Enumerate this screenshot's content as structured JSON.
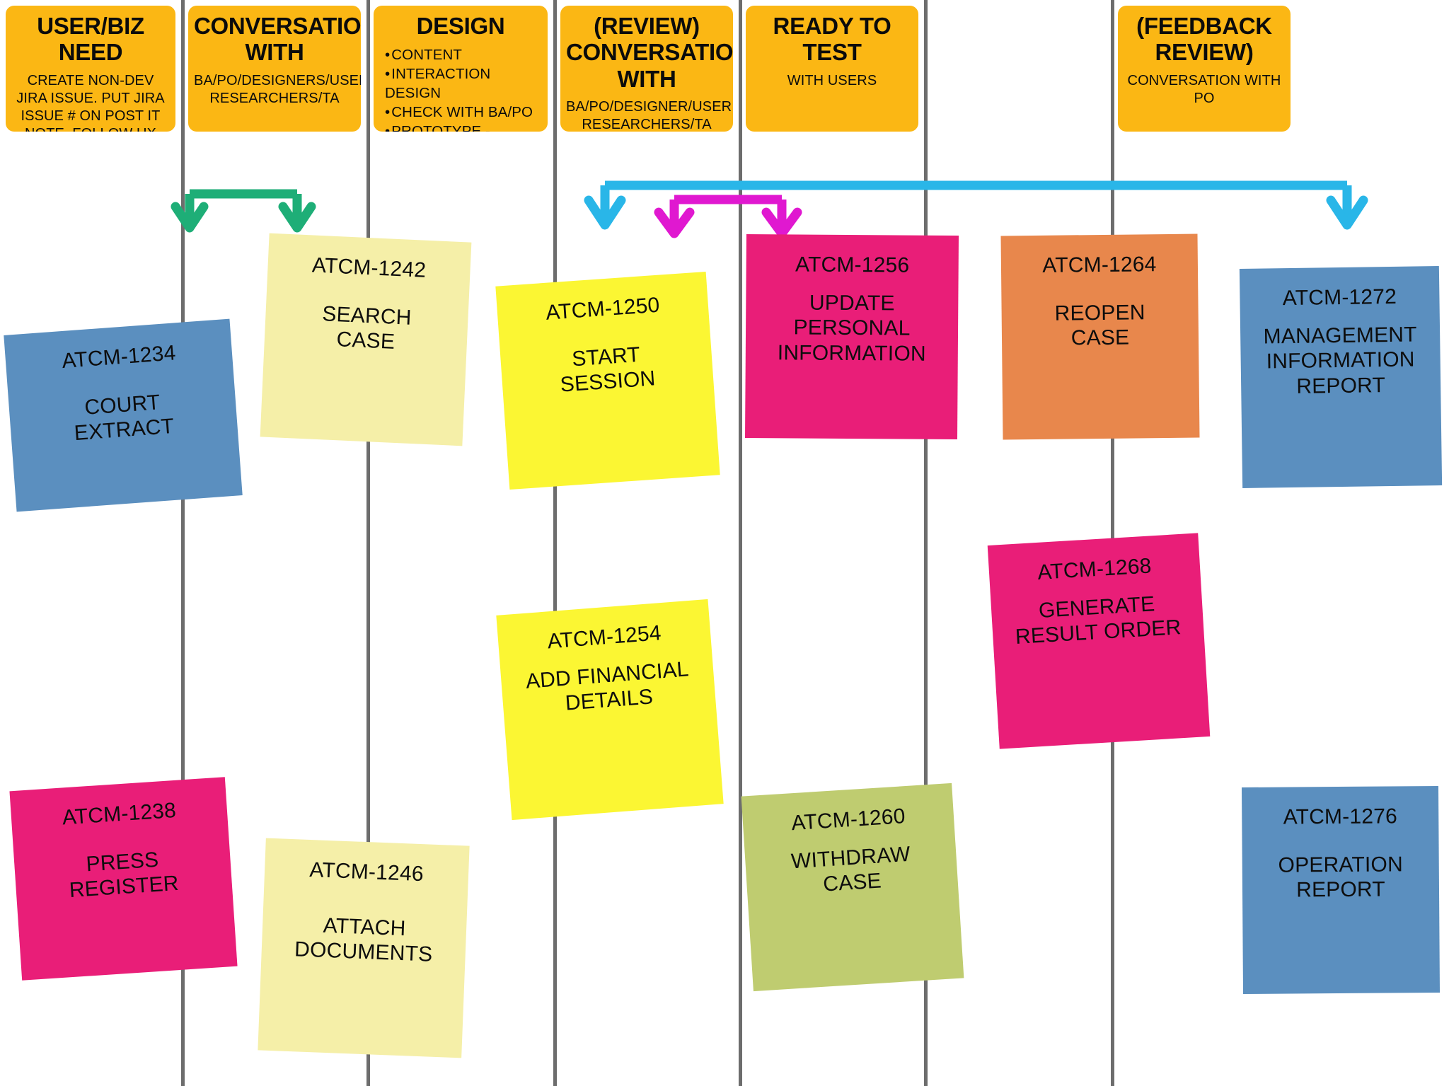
{
  "board": {
    "type": "user-story-map",
    "background_color": "#ffffff",
    "divider_color": "#6d6d6d",
    "header_color": "#FBB714"
  },
  "columns": [
    {
      "id": "user-biz-need",
      "title": "USER/BIZ NEED",
      "subtitle": "CREATE NON-DEV JIRA ISSUE. PUT JIRA ISSUE # ON POST IT NOTE. FOLLOW UX TEMPLATE FOR NEED",
      "bullets": []
    },
    {
      "id": "conversation-with",
      "title": "CONVERSATION WITH",
      "subtitle": "BA/PO/DESIGNERS/USER RESEARCHERS/TA",
      "bullets": []
    },
    {
      "id": "design",
      "title": "DESIGN",
      "subtitle": "",
      "bullets": [
        "CONTENT",
        "INTERACTION DESIGN",
        "CHECK WITH BA/PO",
        "PROTOTYPE - FRONT END"
      ]
    },
    {
      "id": "review-conversation-with",
      "title": "(REVIEW) CONVERSATION WITH",
      "subtitle": "BA/PO/DESIGNER/USER RESEARCHERS/TA",
      "bullets": []
    },
    {
      "id": "ready-to-test",
      "title": "READY TO TEST",
      "subtitle": "WITH USERS",
      "bullets": []
    },
    {
      "id": "feedback-review",
      "title": "(FEEDBACK REVIEW)",
      "subtitle": "CONVERSATION WITH PO",
      "bullets": []
    }
  ],
  "notes": [
    {
      "id": "ATCM-1234",
      "body": "COURT\nEXTRACT",
      "color": "#5B8FBF",
      "column": "user-biz-need"
    },
    {
      "id": "ATCM-1238",
      "body": "PRESS\nREGISTER",
      "color": "#E91E78",
      "column": "user-biz-need"
    },
    {
      "id": "ATCM-1242",
      "body": "SEARCH\nCASE",
      "color": "#F5EFA8",
      "column": "conversation-with"
    },
    {
      "id": "ATCM-1246",
      "body": "ATTACH\nDOCUMENTS",
      "color": "#F5EFA8",
      "column": "conversation-with"
    },
    {
      "id": "ATCM-1250",
      "body": "START\nSESSION",
      "color": "#FBF633",
      "column": "design"
    },
    {
      "id": "ATCM-1254",
      "body": "ADD FINANCIAL\nDETAILS",
      "color": "#FBF633",
      "column": "design"
    },
    {
      "id": "ATCM-1256",
      "body": "UPDATE\nPERSONAL\nINFORMATION",
      "color": "#E91E78",
      "column": "review-conversation-with"
    },
    {
      "id": "ATCM-1260",
      "body": "WITHDRAW\nCASE",
      "color": "#BFCC70",
      "column": "review-conversation-with"
    },
    {
      "id": "ATCM-1264",
      "body": "REOPEN\nCASE",
      "color": "#E8874C",
      "column": "ready-to-test"
    },
    {
      "id": "ATCM-1268",
      "body": "GENERATE\nRESULT ORDER",
      "color": "#E91E78",
      "column": "ready-to-test"
    },
    {
      "id": "ATCM-1272",
      "body": "MANAGEMENT\nINFORMATION\nREPORT",
      "color": "#5B8FBF",
      "column": "feedback-review"
    },
    {
      "id": "ATCM-1276",
      "body": "OPERATION\nREPORT",
      "color": "#5B8FBF",
      "column": "feedback-review"
    }
  ],
  "connectors": [
    {
      "name": "green-bracket",
      "color": "#1EAE77",
      "arrows": 2,
      "from_column": "user-biz-need",
      "to_columns": [
        "user-biz-need",
        "conversation-with"
      ]
    },
    {
      "name": "cyan-bracket",
      "color": "#29B6E8",
      "arrows": 2,
      "from_column": "design",
      "to_columns": [
        "design",
        "feedback-review"
      ]
    },
    {
      "name": "magenta-bracket",
      "color": "#E018D0",
      "arrows": 2,
      "from_column": "design",
      "to_columns": [
        "design",
        "review-conversation-with"
      ]
    }
  ]
}
